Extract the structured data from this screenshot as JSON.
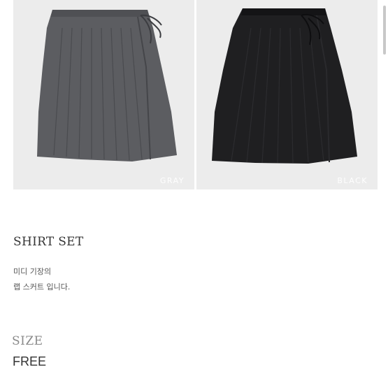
{
  "gallery": {
    "items": [
      {
        "color_label": "GRAY",
        "skirt_color": "#5c5d61"
      },
      {
        "color_label": "BLACK",
        "skirt_color": "#1f1f21"
      }
    ]
  },
  "product": {
    "title": "SHIRT SET",
    "description": [
      "미디 기장의",
      "랩 스커트 입니다."
    ],
    "size_heading": "SIZE",
    "size_value": "FREE"
  }
}
